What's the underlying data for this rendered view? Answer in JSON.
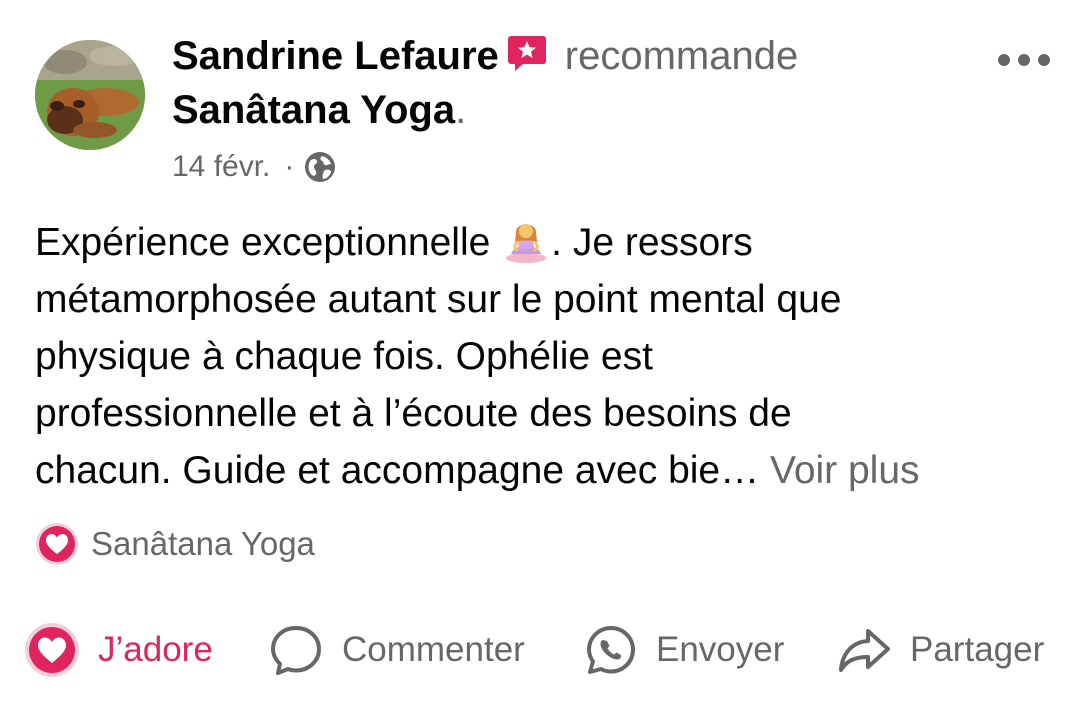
{
  "post": {
    "author": "Sandrine Lefaure",
    "recommend_verb": "recommande",
    "page_name": "Sanâtana Yoga",
    "period": ".",
    "date": "14 févr.",
    "meta_separator": "·",
    "body_lines": [
      "Expérience exceptionnelle",
      ". Je ressors",
      "métamorphosée autant sur le point mental que",
      "physique à chaque fois. Ophélie est",
      "professionnelle et à l’écoute des besoins de",
      "chacun. Guide et accompagne avec bie…"
    ],
    "see_more": "Voir plus",
    "body_emoji": "person-in-lotus-position",
    "reaction": {
      "icon": "love-reaction-icon",
      "name": "Sanâtana Yoga",
      "color": "#e0245e"
    }
  },
  "actions": {
    "like": "J’adore",
    "comment": "Commenter",
    "send": "Envoyer",
    "share": "Partager"
  },
  "colors": {
    "text": "#050505",
    "secondary": "#65676b",
    "love": "#e0245e",
    "badge": "#e0245e"
  }
}
